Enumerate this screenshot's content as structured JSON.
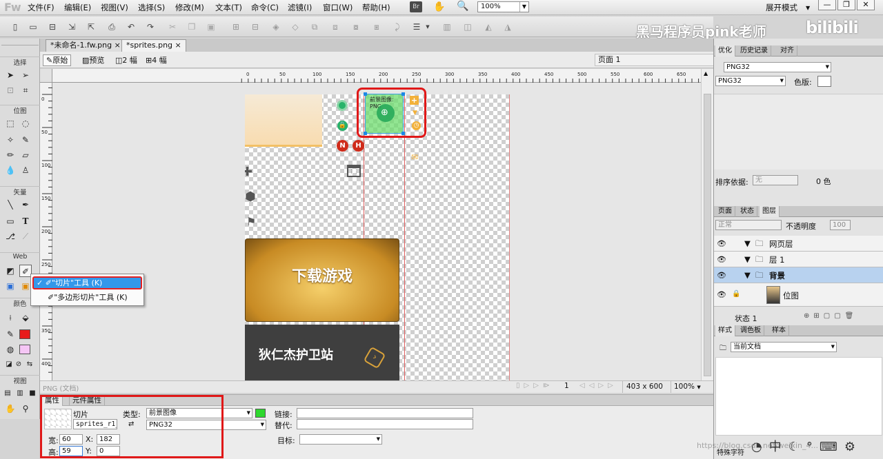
{
  "app": {
    "logo": "Fw",
    "expand_mode": "展开模式"
  },
  "menu": [
    "文件(F)",
    "编辑(E)",
    "视图(V)",
    "选择(S)",
    "修改(M)",
    "文本(T)",
    "命令(C)",
    "滤镜(I)",
    "窗口(W)",
    "帮助(H)"
  ],
  "menubar_tools": {
    "bridge_badge": "Br",
    "zoom_value": "100%"
  },
  "window_buttons": [
    "—",
    "❐",
    "✕"
  ],
  "overlay": {
    "watermark": "黑马程序员pink老师",
    "bilibili": "bilibili",
    "url_watermark": "https://blog.csdn.net/weixin_4..."
  },
  "doc_tabs": [
    "*未命名-1.fw.png",
    "*sprites.png"
  ],
  "view_buttons": [
    "原始",
    "预览",
    "2 幅",
    "4 幅"
  ],
  "page_selector": "页面 1",
  "ruler_h": [
    "0",
    "50",
    "100",
    "150",
    "200",
    "250",
    "300",
    "350",
    "400",
    "450",
    "500",
    "550",
    "600",
    "650",
    "700"
  ],
  "ruler_v": [
    "0",
    "50",
    "100",
    "150",
    "200",
    "250",
    "300",
    "350",
    "400"
  ],
  "tools": {
    "sections": [
      "选择",
      "位图",
      "矢量",
      "Web",
      "颜色",
      "视图"
    ],
    "stroke_color": "#3a3a3a",
    "fill_color": "#e81b1b",
    "fill2_color": "#f5c6f5"
  },
  "context_menu": {
    "item1": "\"切片\"工具 (K)",
    "item2": "\"多边形切片\"工具 (K)"
  },
  "canvas": {
    "slice_label": "前景图像: PNG",
    "download_banner": "下载游戏",
    "guard_banner": "狄仁杰护卫站",
    "sprite_letters": [
      "N",
      "H"
    ]
  },
  "doc_status": {
    "type": "PNG (文档)",
    "frame": "1",
    "size": "403 x 600",
    "zoom": "100%"
  },
  "properties": {
    "tabs": [
      "属性",
      "元件属性"
    ],
    "object_type": "切片",
    "slice_name": "sprites_r1_",
    "type_label": "类型:",
    "type_value": "前景图像",
    "format_value": "PNG32",
    "slice_color": "#2ed82e",
    "link_label": "链接:",
    "alt_label": "替代:",
    "target_label": "目标:",
    "w_label": "宽:",
    "w_value": "60",
    "h_label": "高:",
    "h_value": "59",
    "x_label": "X:",
    "x_value": "182",
    "y_label": "Y:",
    "y_value": "0"
  },
  "optimize": {
    "tabs": [
      "优化",
      "历史记录",
      "对齐"
    ],
    "preset": "PNG32",
    "format": "PNG32",
    "palette_label": "色版:",
    "sort_label": "排序依据:",
    "sort_value": "无",
    "colors_label": "0 色"
  },
  "layers": {
    "tabs": [
      "页面",
      "状态",
      "图层"
    ],
    "blend_mode": "正常",
    "opacity_label": "不透明度",
    "opacity_value": "100",
    "rows": [
      "网页层",
      "层 1",
      "背景",
      "位图"
    ],
    "state_label": "状态 1"
  },
  "styles": {
    "tabs": [
      "样式",
      "调色板",
      "样本"
    ],
    "doc_select": "当前文档",
    "bottom_label": "特殊字符"
  }
}
